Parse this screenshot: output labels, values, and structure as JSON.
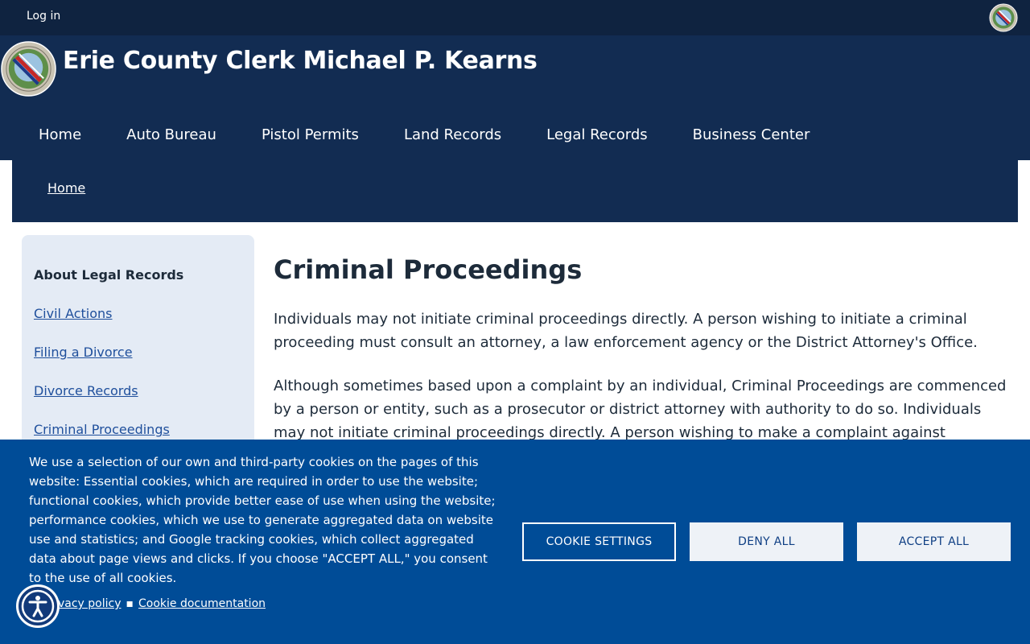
{
  "topbar": {
    "login_label": "Log in"
  },
  "header": {
    "title": "Erie County Clerk Michael P. Kearns",
    "nav": [
      "Home",
      "Auto Bureau",
      "Pistol Permits",
      "Land Records",
      "Legal Records",
      "Business Center"
    ]
  },
  "breadcrumb": {
    "home": "Home"
  },
  "sidebar": {
    "heading": "About Legal Records",
    "links": [
      "Civil Actions",
      "Filing a Divorce",
      "Divorce Records",
      "Criminal Proceedings"
    ]
  },
  "main": {
    "title": "Criminal Proceedings",
    "paragraphs": [
      "Individuals may not initiate criminal proceedings directly. A person wishing to initiate a criminal proceeding must consult an attorney, a law enforcement agency or the District Attorney's Office.",
      "Although sometimes based upon a complaint by an individual, Criminal Proceedings are commenced by a person or entity, such as a prosecutor or district attorney with authority to do so. Individuals may not initiate criminal proceedings directly. A person wishing to make a complaint against"
    ]
  },
  "cookie_banner": {
    "text": "We use a selection of our own and third-party cookies on the pages of this website: Essential cookies, which are required in order to use the website; functional cookies, which provide better ease of use when using the website; performance cookies, which we use to generate aggregated data on website use and statistics; and Google tracking cookies, which collect aggregated data about page views and clicks. If you choose \"ACCEPT ALL,\" you consent to the use of all cookies.",
    "privacy_link": "vacy policy",
    "docs_link": "Cookie documentation",
    "separator": "▪",
    "settings_label": "COOKIE SETTINGS",
    "deny_label": "DENY ALL",
    "accept_label": "ACCEPT ALL"
  },
  "icons": {
    "county_seal": "county-seal-icon",
    "accessibility": "accessibility-icon"
  },
  "colors": {
    "topbar": "#0f2340",
    "header": "#122c52",
    "cookie_banner": "#004c97",
    "link": "#1f4f9c",
    "sidebar_bg": "#e4ebf5"
  }
}
